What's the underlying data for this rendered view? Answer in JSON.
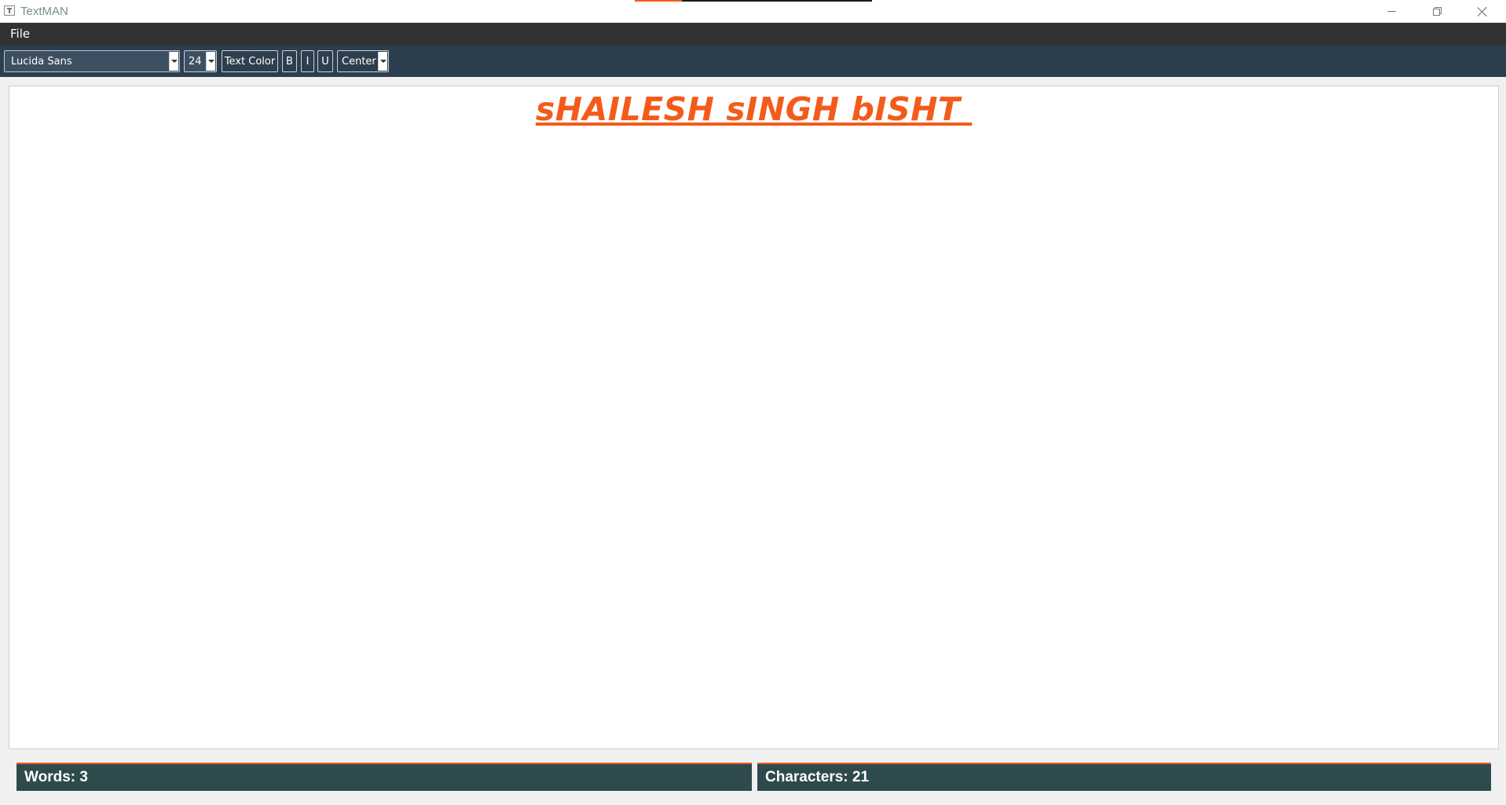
{
  "window": {
    "title": "TextMAN"
  },
  "menu": {
    "file_label": "File"
  },
  "toolbar": {
    "font_family": "Lucida Sans",
    "font_size": "24",
    "text_color_label": "Text Color",
    "bold_label": "B",
    "italic_label": "I",
    "underline_label": "U",
    "alignment": "Center"
  },
  "editor": {
    "content": "sHAILESH sINGH bISHT ",
    "text_color": "#f45b1a"
  },
  "status": {
    "words": "Words: 3",
    "characters": "Characters: 21"
  },
  "theme": {
    "menubar_bg": "#323232",
    "toolbar_bg": "#2d3e4e",
    "status_bg": "#2f4a4c",
    "accent": "#f45b1a"
  }
}
